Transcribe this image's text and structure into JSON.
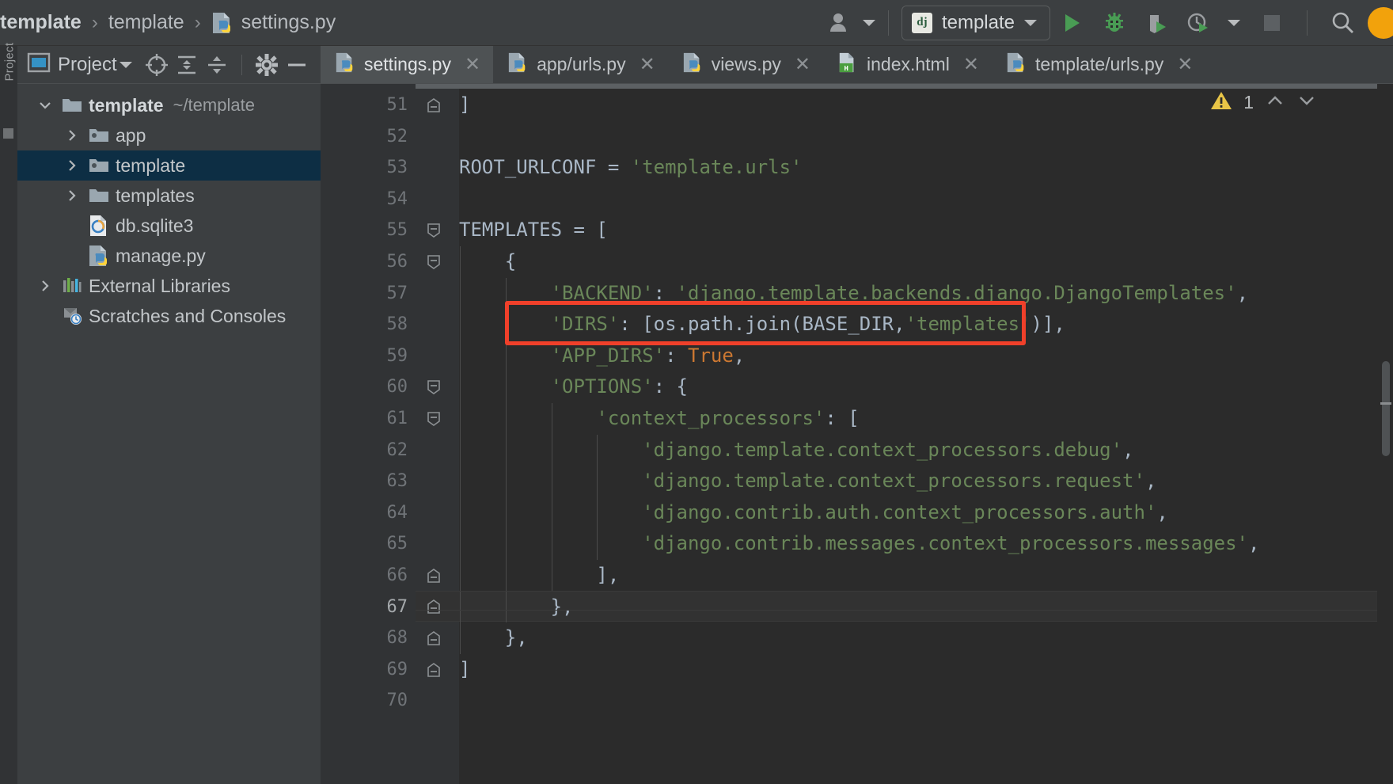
{
  "window": {
    "theme_bg": "#3c3f41",
    "editor_bg": "#2b2b2b",
    "accent_selection": "#0d2e44",
    "annotation_color": "#f0402a"
  },
  "breadcrumb": {
    "items": [
      "template",
      "template",
      "settings.py"
    ],
    "separator": "›",
    "file_icon": "python-file-icon"
  },
  "toolbar": {
    "user_icon": "user-accounts-icon",
    "run_config": {
      "badge": "dj",
      "name": "template",
      "dropdown_icon": "chevron-down-icon"
    },
    "buttons": [
      {
        "name": "run-button",
        "icon": "run-triangle-icon",
        "label": "Run"
      },
      {
        "name": "debug-button",
        "icon": "debug-bug-icon",
        "label": "Debug"
      },
      {
        "name": "run-with-coverage-button",
        "icon": "coverage-shield-icon",
        "label": "Run with Coverage"
      },
      {
        "name": "profile-button",
        "icon": "profiler-clock-icon",
        "label": "Profile"
      },
      {
        "name": "profile-dropdown",
        "icon": "chevron-down-icon",
        "label": "More"
      },
      {
        "name": "stop-button",
        "icon": "stop-square-icon",
        "label": "Stop"
      },
      {
        "name": "search-everywhere-button",
        "icon": "search-icon",
        "label": "Search Everywhere"
      }
    ]
  },
  "left_strip": {
    "vertical_label": "Project"
  },
  "project_panel": {
    "title": "Project",
    "title_icon": "project-view-icon",
    "title_caret": "chevron-down-icon",
    "toolbar_buttons": [
      {
        "name": "select-opened-file-button",
        "icon": "crosshair-target-icon"
      },
      {
        "name": "expand-all-button",
        "icon": "expand-all-icon"
      },
      {
        "name": "collapse-all-button",
        "icon": "collapse-all-icon"
      },
      {
        "name": "settings-button",
        "icon": "gear-icon"
      },
      {
        "name": "hide-panel-button",
        "icon": "minimize-icon"
      }
    ],
    "tree": [
      {
        "label": "template",
        "suffix": "~/template",
        "depth": 0,
        "arrow": "expanded",
        "icon": "folder-icon",
        "bold": true,
        "selected": false
      },
      {
        "label": "app",
        "suffix": "",
        "depth": 1,
        "arrow": "collapsed",
        "icon": "module-folder-icon",
        "bold": false,
        "selected": false
      },
      {
        "label": "template",
        "suffix": "",
        "depth": 1,
        "arrow": "collapsed",
        "icon": "module-folder-icon",
        "bold": false,
        "selected": true
      },
      {
        "label": "templates",
        "suffix": "",
        "depth": 1,
        "arrow": "collapsed",
        "icon": "folder-icon",
        "bold": false,
        "selected": false
      },
      {
        "label": "db.sqlite3",
        "suffix": "",
        "depth": 2,
        "arrow": "none",
        "icon": "sqlite-file-icon",
        "bold": false,
        "selected": false
      },
      {
        "label": "manage.py",
        "suffix": "",
        "depth": 2,
        "arrow": "none",
        "icon": "python-file-icon",
        "bold": false,
        "selected": false
      },
      {
        "label": "External Libraries",
        "suffix": "",
        "depth": 0,
        "arrow": "collapsed",
        "icon": "libraries-icon",
        "bold": false,
        "selected": false
      },
      {
        "label": "Scratches and Consoles",
        "suffix": "",
        "depth": 0,
        "arrow": "none",
        "icon": "scratches-icon",
        "bold": false,
        "selected": false
      }
    ]
  },
  "editor_tabs": [
    {
      "label": "settings.py",
      "icon": "python-file-icon",
      "active": true,
      "close_icon": "close-icon"
    },
    {
      "label": "app/urls.py",
      "icon": "python-file-icon",
      "active": false,
      "close_icon": "close-icon"
    },
    {
      "label": "views.py",
      "icon": "python-file-icon",
      "active": false,
      "close_icon": "close-icon"
    },
    {
      "label": "index.html",
      "icon": "html-file-icon",
      "active": false,
      "close_icon": "close-icon"
    },
    {
      "label": "template/urls.py",
      "icon": "python-file-icon",
      "active": false,
      "close_icon": "close-icon"
    }
  ],
  "inspection_widget": {
    "warning_icon": "warning-triangle-icon",
    "count": "1",
    "prev_icon": "chevron-up-icon",
    "next_icon": "chevron-down-icon"
  },
  "editor": {
    "current_line": 67,
    "first_line": 51,
    "lines": [
      {
        "n": 51,
        "fold": "end",
        "indent": 0,
        "tokens": [
          {
            "t": "]",
            "c": "op"
          }
        ]
      },
      {
        "n": 52,
        "fold": "",
        "indent": 0,
        "tokens": []
      },
      {
        "n": 53,
        "fold": "",
        "indent": 0,
        "tokens": [
          {
            "t": "ROOT_URLCONF",
            "c": "id"
          },
          {
            "t": " = ",
            "c": "op"
          },
          {
            "t": "'template.urls'",
            "c": "str"
          }
        ]
      },
      {
        "n": 54,
        "fold": "",
        "indent": 0,
        "tokens": []
      },
      {
        "n": 55,
        "fold": "start",
        "indent": 0,
        "tokens": [
          {
            "t": "TEMPLATES",
            "c": "id"
          },
          {
            "t": " = [",
            "c": "op"
          }
        ]
      },
      {
        "n": 56,
        "fold": "start",
        "indent": 1,
        "tokens": [
          {
            "t": "{",
            "c": "op"
          }
        ]
      },
      {
        "n": 57,
        "fold": "",
        "indent": 2,
        "tokens": [
          {
            "t": "'BACKEND'",
            "c": "str"
          },
          {
            "t": ": ",
            "c": "op"
          },
          {
            "t": "'django.template.backends.django.DjangoTemplates'",
            "c": "str"
          },
          {
            "t": ",",
            "c": "op"
          }
        ]
      },
      {
        "n": 58,
        "fold": "",
        "indent": 2,
        "tokens": [
          {
            "t": "'DIRS'",
            "c": "str"
          },
          {
            "t": ": [",
            "c": "op"
          },
          {
            "t": "os",
            "c": "id"
          },
          {
            "t": ".",
            "c": "op"
          },
          {
            "t": "path",
            "c": "id"
          },
          {
            "t": ".",
            "c": "op"
          },
          {
            "t": "join",
            "c": "id"
          },
          {
            "t": "(",
            "c": "op"
          },
          {
            "t": "BASE_DIR",
            "c": "id"
          },
          {
            "t": ",",
            "c": "op"
          },
          {
            "t": "'templates'",
            "c": "str"
          },
          {
            "t": ")],",
            "c": "op"
          }
        ]
      },
      {
        "n": 59,
        "fold": "",
        "indent": 2,
        "tokens": [
          {
            "t": "'APP_DIRS'",
            "c": "str"
          },
          {
            "t": ": ",
            "c": "op"
          },
          {
            "t": "True",
            "c": "kw"
          },
          {
            "t": ",",
            "c": "op"
          }
        ]
      },
      {
        "n": 60,
        "fold": "start",
        "indent": 2,
        "tokens": [
          {
            "t": "'OPTIONS'",
            "c": "str"
          },
          {
            "t": ": {",
            "c": "op"
          }
        ]
      },
      {
        "n": 61,
        "fold": "start",
        "indent": 3,
        "tokens": [
          {
            "t": "'context_processors'",
            "c": "str"
          },
          {
            "t": ": [",
            "c": "op"
          }
        ]
      },
      {
        "n": 62,
        "fold": "",
        "indent": 4,
        "tokens": [
          {
            "t": "'django.template.context_processors.debug'",
            "c": "str"
          },
          {
            "t": ",",
            "c": "op"
          }
        ]
      },
      {
        "n": 63,
        "fold": "",
        "indent": 4,
        "tokens": [
          {
            "t": "'django.template.context_processors.request'",
            "c": "str"
          },
          {
            "t": ",",
            "c": "op"
          }
        ]
      },
      {
        "n": 64,
        "fold": "",
        "indent": 4,
        "tokens": [
          {
            "t": "'django.contrib.auth.context_processors.auth'",
            "c": "str"
          },
          {
            "t": ",",
            "c": "op"
          }
        ]
      },
      {
        "n": 65,
        "fold": "",
        "indent": 4,
        "tokens": [
          {
            "t": "'django.contrib.messages.context_processors.messages'",
            "c": "str"
          },
          {
            "t": ",",
            "c": "op"
          }
        ]
      },
      {
        "n": 66,
        "fold": "end",
        "indent": 3,
        "tokens": [
          {
            "t": "],",
            "c": "op"
          }
        ]
      },
      {
        "n": 67,
        "fold": "end",
        "indent": 2,
        "tokens": [
          {
            "t": "},",
            "c": "op"
          }
        ]
      },
      {
        "n": 68,
        "fold": "end",
        "indent": 1,
        "tokens": [
          {
            "t": "},",
            "c": "op"
          }
        ]
      },
      {
        "n": 69,
        "fold": "end",
        "indent": 0,
        "tokens": [
          {
            "t": "]",
            "c": "op"
          }
        ]
      },
      {
        "n": 70,
        "fold": "",
        "indent": 0,
        "tokens": []
      }
    ]
  },
  "annotation": {
    "shape": "rectangle",
    "around_line": 58,
    "label": "DIRS line highlight"
  }
}
